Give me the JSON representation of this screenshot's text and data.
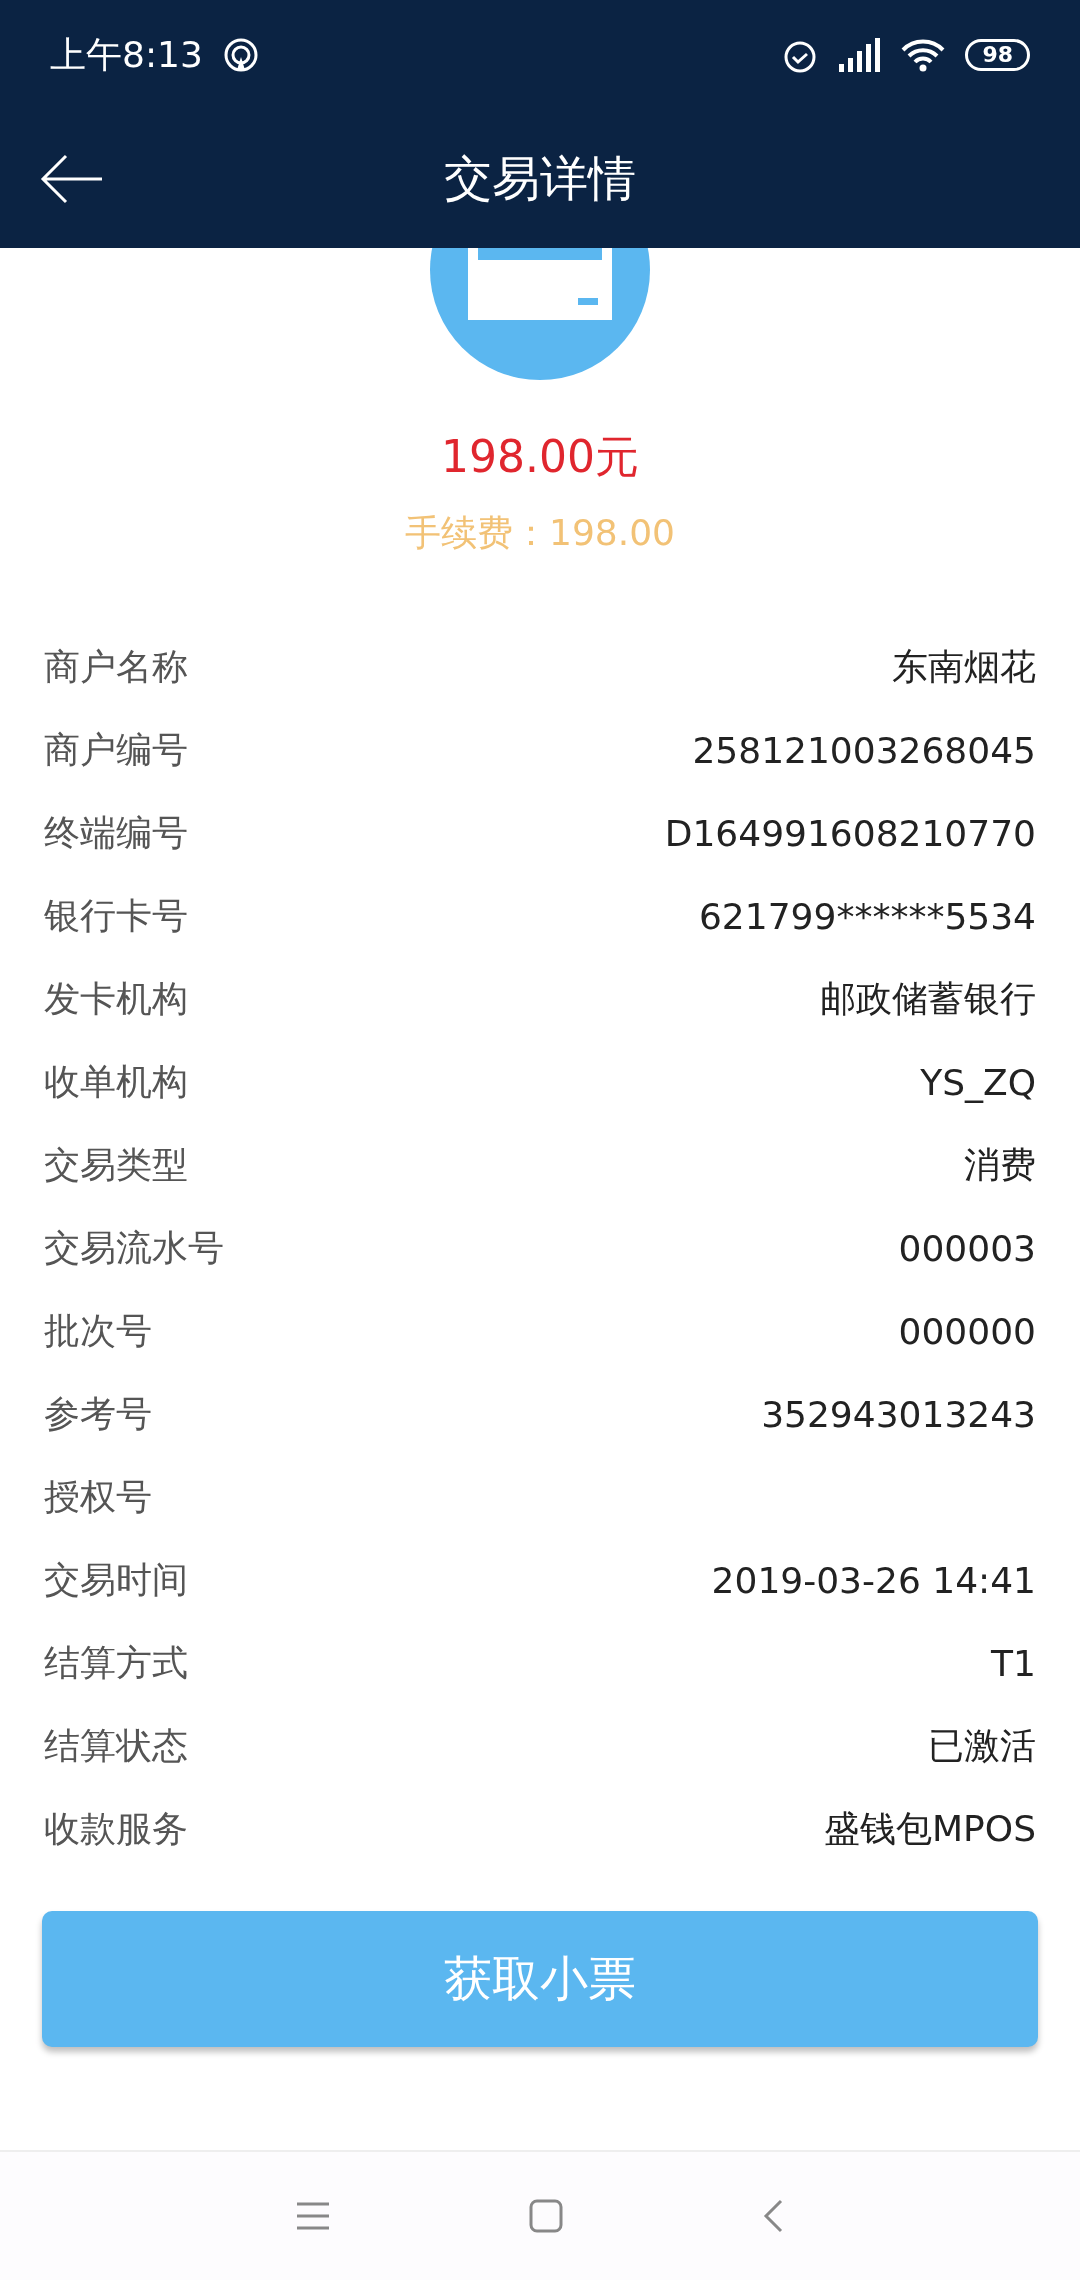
{
  "status_bar": {
    "time": "上午8:13",
    "battery": "98"
  },
  "header": {
    "title": "交易详情"
  },
  "summary": {
    "amount": "198.00元",
    "fee": "手续费：198.00"
  },
  "details": [
    {
      "label": "商户名称",
      "value": "东南烟花"
    },
    {
      "label": "商户编号",
      "value": "258121003268045"
    },
    {
      "label": "终端编号",
      "value": "D164991608210770"
    },
    {
      "label": "银行卡号",
      "value": "621799******5534"
    },
    {
      "label": "发卡机构",
      "value": "邮政储蓄银行"
    },
    {
      "label": "收单机构",
      "value": "YS_ZQ"
    },
    {
      "label": "交易类型",
      "value": "消费"
    },
    {
      "label": "交易流水号",
      "value": "000003"
    },
    {
      "label": "批次号",
      "value": "000000"
    },
    {
      "label": "参考号",
      "value": "352943013243"
    },
    {
      "label": "授权号"
    },
    {
      "label": "交易时间",
      "value": "2019-03-26 14:41"
    },
    {
      "label": "结算方式",
      "value": "T1"
    },
    {
      "label": "结算状态",
      "value": "已激活"
    },
    {
      "label": "收款服务",
      "value": "盛钱包MPOS"
    }
  ],
  "action_button": {
    "label": "获取小票"
  }
}
